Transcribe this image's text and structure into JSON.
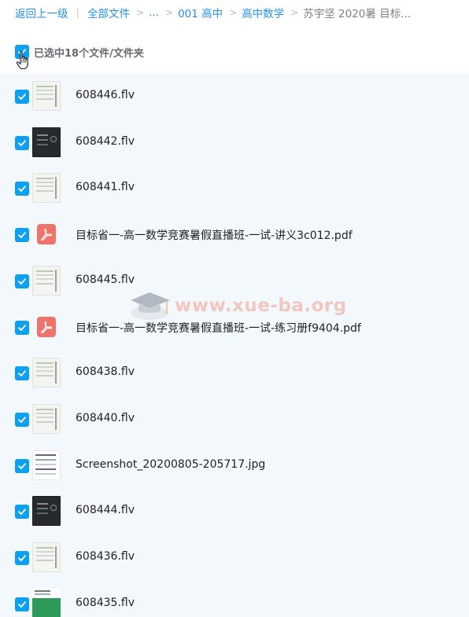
{
  "breadcrumb": {
    "back": "返回上一级",
    "all_files": "全部文件",
    "ellipsis": "...",
    "level1": "001 高中",
    "level2": "高中数学",
    "current": "苏宇坚 2020暑 目标..."
  },
  "selection": {
    "label": "已选中18个文件/文件夹"
  },
  "files": [
    {
      "name": "608446.flv",
      "thumb": "video-light"
    },
    {
      "name": "608442.flv",
      "thumb": "video-dark"
    },
    {
      "name": "608441.flv",
      "thumb": "video-light"
    },
    {
      "name": "目标省一-高一数学竞赛暑假直播班-一试-讲义3c012.pdf",
      "thumb": "pdf-icon"
    },
    {
      "name": "608445.flv",
      "thumb": "video-light"
    },
    {
      "name": "目标省一-高一数学竞赛暑假直播班-一试-练习册f9404.pdf",
      "thumb": "pdf-icon"
    },
    {
      "name": "608438.flv",
      "thumb": "video-light"
    },
    {
      "name": "608440.flv",
      "thumb": "video-light"
    },
    {
      "name": "Screenshot_20200805-205717.jpg",
      "thumb": "image-screenshot"
    },
    {
      "name": "608444.flv",
      "thumb": "video-dark"
    },
    {
      "name": "608436.flv",
      "thumb": "video-light"
    },
    {
      "name": "608435.flv",
      "thumb": "video-green"
    }
  ],
  "watermark": {
    "text": "www.xue-ba.org"
  },
  "colors": {
    "accent": "#0ea0f0",
    "link": "#1e92f0",
    "list_bg": "#f3f8fc",
    "pdf_red": "#f0736b"
  }
}
